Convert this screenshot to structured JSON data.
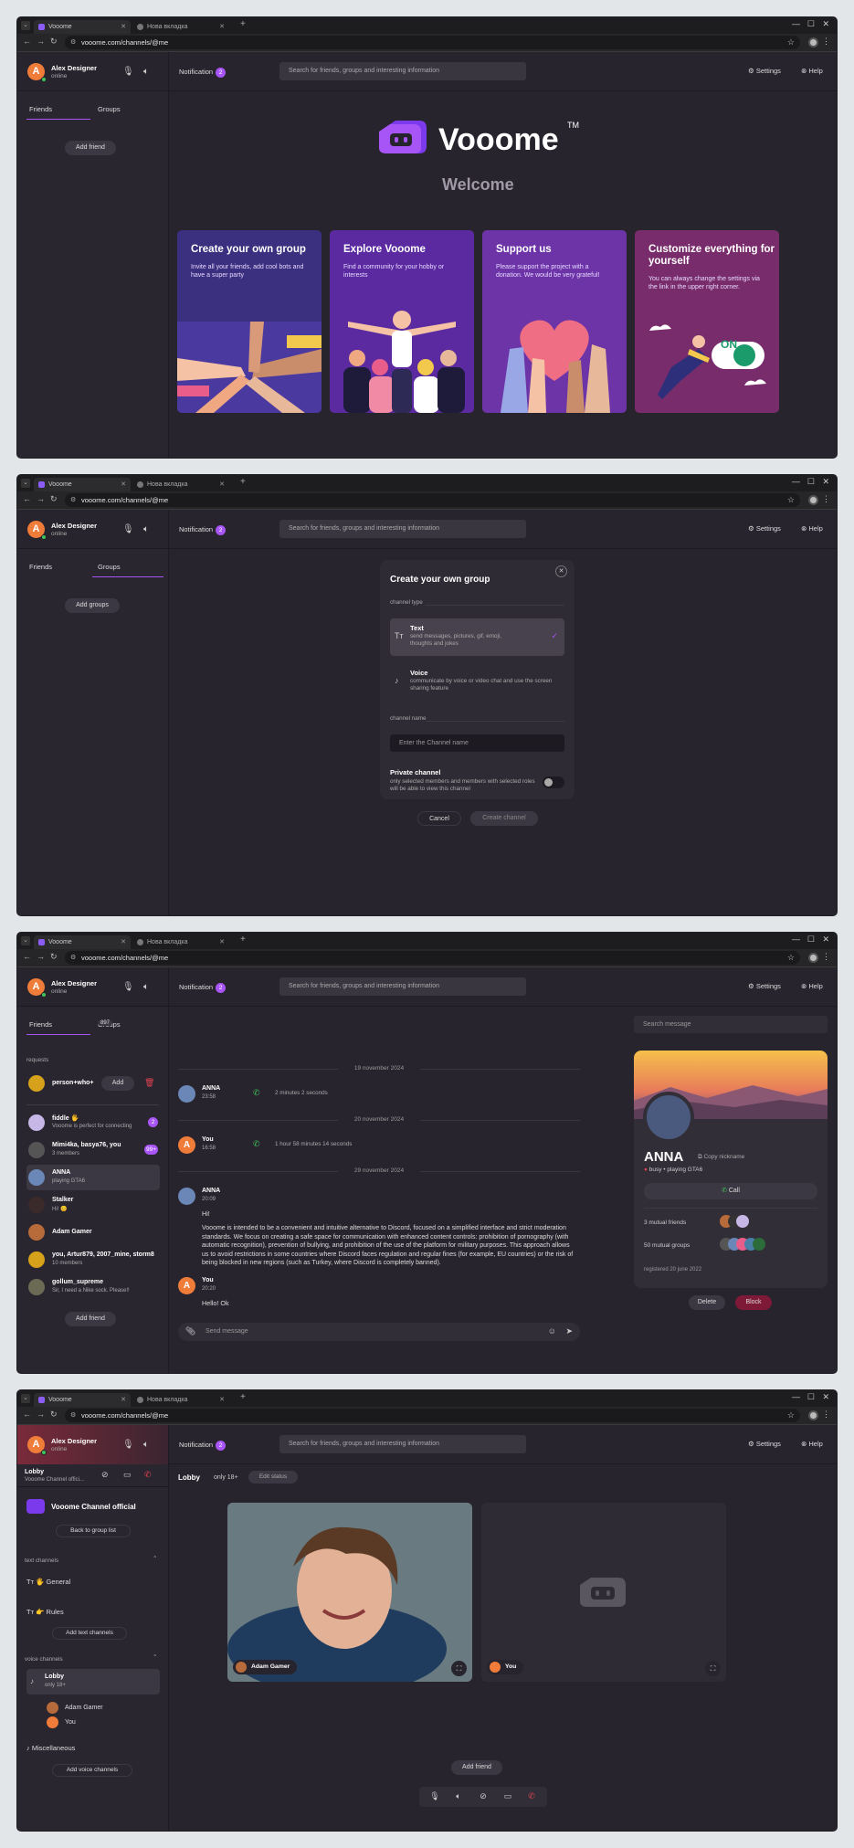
{
  "browser": {
    "tab_active": "Vooome",
    "tab_inactive": "Нова вкладка",
    "url": "vooome.com/channels/@me",
    "new_tab": "+"
  },
  "user": {
    "name": "Alex Designer",
    "status": "online",
    "initial": "A"
  },
  "topbar": {
    "notification_label": "Notification",
    "notification_count": "2",
    "search_placeholder": "Search for friends, groups and interesting information",
    "settings": "Settings",
    "help": "Help"
  },
  "icons": {
    "mic": "mic-icon",
    "speaker": "speaker-icon",
    "gear": "gear-icon",
    "help": "help-icon",
    "bell": "bell-icon",
    "phone": "phone-icon",
    "send": "send-icon",
    "clip": "paperclip-icon",
    "emoji": "emoji-icon"
  },
  "colors": {
    "accent": "#a855f7",
    "bg": "#28242d",
    "sidebar": "#2a2630",
    "block": "#7e1a37",
    "call_green": "#3fc35a",
    "end_red": "#e0424f"
  },
  "screen1": {
    "tabs": {
      "friends": "Friends",
      "groups": "Groups"
    },
    "add_friend": "Add friend",
    "brand": "Vooome",
    "tm": "TM",
    "welcome": "Welcome",
    "cards": [
      {
        "title": "Create your own group",
        "text": "Invite all your friends, add cool bots and have a super party"
      },
      {
        "title": "Explore Vooome",
        "text": "Find a community for your hobby or interests"
      },
      {
        "title": "Support us",
        "text": "Please support the project with a donation. We would be very grateful!"
      },
      {
        "title": "Customize everything for yourself",
        "text": "You can always change the settings via the link in the upper right corner.",
        "badge": "ON"
      }
    ]
  },
  "screen2": {
    "tabs": {
      "friends": "Friends",
      "groups": "Groups"
    },
    "add_groups": "Add groups",
    "modal": {
      "title": "Create your own group",
      "channel_type": "channel type",
      "text_title": "Text",
      "text_desc": "send messages, pictures, gif, emoji, thoughts and jokes",
      "voice_title": "Voice",
      "voice_desc": "communicate by voice or video chat and use the screen sharing feature",
      "channel_name": "channel name",
      "name_placeholder": "Enter the Channel name",
      "private_title": "Private channel",
      "private_desc": "only selected members and members with selected roles will be able to view this channel"
    },
    "cancel": "Cancel",
    "create": "Create channel"
  },
  "screen3": {
    "tabs": {
      "friends": "Friends",
      "groups": "Groups",
      "groups_count": "897"
    },
    "requests_label": "requests",
    "request": {
      "name": "person+who+",
      "add": "Add"
    },
    "friends": [
      {
        "name": "fiddle 🖐",
        "status": "Vooome is perfect for connecting",
        "badge": "2"
      },
      {
        "name": "Mimi4ka, basya76, you",
        "status": "3 members",
        "badge": "99+"
      },
      {
        "name": "ANNA",
        "status": "playing GTA6"
      },
      {
        "name": "Stalker",
        "status": "Hi! 😊"
      },
      {
        "name": "Adam Gamer",
        "status": ""
      },
      {
        "name": "you, Artur879, 2007_mine, storm8",
        "status": "10 members"
      },
      {
        "name": "gollum_supreme",
        "status": "Sir, I need a Nike sock. Please!!"
      }
    ],
    "add_friend": "Add friend",
    "chat": [
      {
        "date": "19 november 2024",
        "name": "ANNA",
        "time": "23:58",
        "call": "2 minutes 2 seconds"
      },
      {
        "date": "20 november 2024",
        "name": "You",
        "time": "16:58",
        "call": "1 hour 58 minutes 14 seconds"
      },
      {
        "date": "29 november 2024",
        "name": "ANNA",
        "time": "20:09",
        "lines": [
          "Hi!",
          "Vooome is intended to be a convenient and intuitive alternative to Discord, focused on a simplified interface and strict moderation standards. We focus on creating a safe space for communication with enhanced content controls: prohibition of pornography (with automatic recognition), prevention of bullying, and prohibition of the use of the platform for military purposes. This approach allows us to avoid restrictions in some countries where Discord faces regulation and regular fines (for example, EU countries) or the risk of being blocked in new regions (such as Turkey, where Discord is completely banned)."
        ]
      },
      {
        "name": "You",
        "time": "20:20",
        "lines": [
          "Hello! Ok"
        ]
      }
    ],
    "send_placeholder": "Send message",
    "search_message": "Search message",
    "profile": {
      "name": "ANNA",
      "copy": "Copy nickname",
      "status": "busy",
      "activity": "playing GTA6",
      "call": "Call",
      "mutual_friends": "3 mutual friends",
      "mutual_groups": "50 mutual groups",
      "registered": "registered 20 june 2022",
      "delete": "Delete",
      "block": "Block"
    }
  },
  "screen4": {
    "lobby": {
      "name": "Lobby",
      "sub": "Vooome Channel offici..."
    },
    "server": "Vooome Channel official",
    "back": "Back to group list",
    "text_channels": "text channels",
    "channels": [
      "General",
      "Rules"
    ],
    "add_text": "Add text channels",
    "voice_channels": "voice channels",
    "voice": {
      "name": "Lobby",
      "sub": "only 18+",
      "members": [
        "Adam Gamer",
        "You"
      ]
    },
    "misc": "Miscellaneous",
    "add_voice": "Add voice channels",
    "header": {
      "name": "Lobby",
      "tag": "only 18+",
      "edit": "Edit status"
    },
    "tiles": [
      "Adam Gamer",
      "You"
    ],
    "add_friend": "Add friend"
  }
}
